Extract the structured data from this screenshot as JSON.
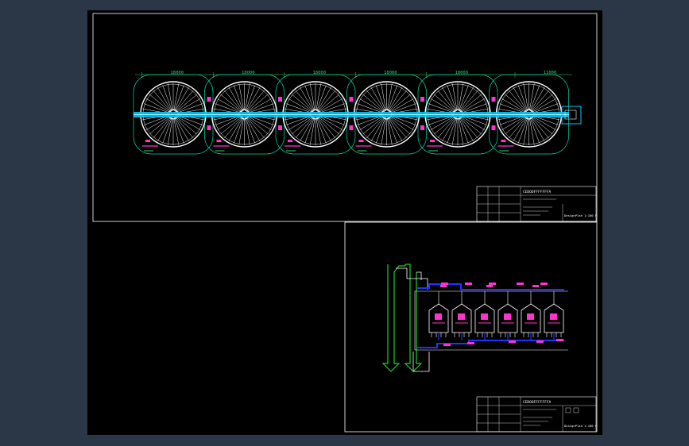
{
  "layout_plan": {
    "dimensions": [
      "18000",
      "18000",
      "18000",
      "18000",
      "18000",
      "11000"
    ],
    "tank_count": 6
  },
  "title_blocks": [
    {
      "header_text": "CEDOOFFFFFFFA",
      "drawing_ref": "DesignPlan 1:100 F"
    },
    {
      "header_text": "CEDOOFFFFFFFA",
      "drawing_ref": "DesignPlan 1:100 F"
    }
  ],
  "colors": {
    "background": "#000000",
    "frame": "#ffffff",
    "tank": "#ffffff",
    "pipe_main": "#00c8ff",
    "outline": "#00d6a0",
    "dimension": "#2fd27a",
    "label": "#ff33cc",
    "flow_blue": "#2233ff",
    "flow_green": "#22cc22"
  }
}
